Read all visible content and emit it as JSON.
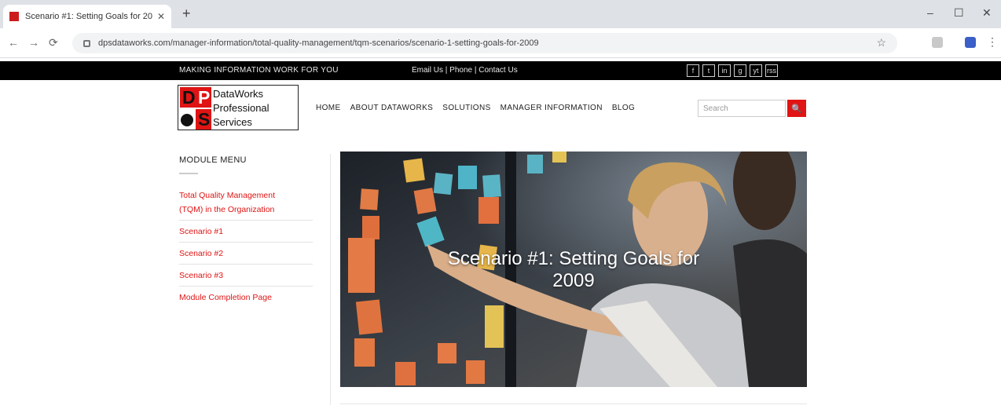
{
  "browser": {
    "tab_title": "Scenario #1: Setting Goals for 20",
    "tab_close": "✕",
    "new_tab": "+",
    "url": "dpsdataworks.com/manager-information/total-quality-management/tqm-scenarios/scenario-1-setting-goals-for-2009",
    "window_controls": [
      "–",
      "☐",
      "✕"
    ],
    "nav": {
      "back": "←",
      "forward": "→",
      "reload": "⟳"
    },
    "menu": "⋮"
  },
  "topbar": {
    "tagline": "MAKING INFORMATION WORK FOR YOU",
    "contact": "Email Us   |   Phone   |   Contact Us",
    "social": [
      "f",
      "t",
      "in",
      "g",
      "yt",
      "rss"
    ]
  },
  "logo": {
    "letters": [
      "D",
      "P",
      "S"
    ],
    "lines": [
      "DataWorks",
      "Professional",
      "Services"
    ]
  },
  "nav": {
    "items": [
      "HOME",
      "ABOUT DATAWORKS",
      "SOLUTIONS",
      "MANAGER INFORMATION",
      "BLOG"
    ]
  },
  "search": {
    "placeholder": "Search",
    "button": "🔍"
  },
  "sidebar": {
    "title": "MODULE MENU",
    "links": [
      "Total Quality Management",
      "(TQM) in the Organization",
      "Scenario #1",
      "Scenario #2",
      "Scenario #3",
      "Module Completion Page"
    ]
  },
  "hero": {
    "title": "Scenario #1: Setting Goals for 2009"
  }
}
